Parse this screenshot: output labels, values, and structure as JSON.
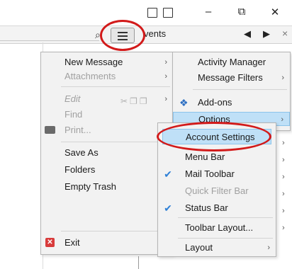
{
  "title_bar": {
    "buttons": [
      {
        "name": "calendar-icon"
      },
      {
        "name": "tasks-icon"
      },
      {
        "name": "minimize",
        "glyph": "–"
      },
      {
        "name": "restore",
        "glyph": "⧉"
      },
      {
        "name": "close",
        "glyph": "✕"
      }
    ]
  },
  "toolbar": {
    "tab_partial": "vents",
    "nav_back": "◀",
    "nav_forward": "▶",
    "tab_close": "×"
  },
  "main_menu": {
    "items": [
      {
        "label": "New Message",
        "arrow": "›",
        "disabled": false
      },
      {
        "label": "Attachments",
        "arrow": "›",
        "disabled": true
      },
      {
        "label": "Edit",
        "arrow": "›",
        "disabled": true,
        "italic": true
      },
      {
        "label": "Find",
        "disabled": true
      },
      {
        "label": "Print...",
        "disabled": true
      },
      {
        "label": "Save As",
        "disabled": false
      },
      {
        "label": "Folders",
        "disabled": false
      },
      {
        "label": "Empty Trash",
        "disabled": false
      },
      {
        "label": "Exit",
        "disabled": false
      }
    ]
  },
  "tools_menu": {
    "items": [
      {
        "label": "Activity Manager"
      },
      {
        "label": "Message Filters",
        "arrow": "›"
      },
      {
        "label": "Add-ons"
      },
      {
        "label": "Options",
        "arrow": "›"
      }
    ]
  },
  "options_submenu": {
    "items": [
      {
        "label": "Account Settings",
        "highlighted": true
      },
      {
        "label": "Menu Bar",
        "arrow": "›"
      },
      {
        "label": "Mail Toolbar",
        "checked": true,
        "arrow": "›"
      },
      {
        "label": "Quick Filter Bar",
        "disabled": true,
        "arrow": "›"
      },
      {
        "label": "Status Bar",
        "checked": true,
        "arrow": "›"
      },
      {
        "label": "Toolbar Layout...",
        "arrow": "›"
      },
      {
        "label": "Layout",
        "arrow": "›"
      }
    ]
  },
  "colors": {
    "highlight": "#bfe0f7",
    "annotation_red": "#d21a1a",
    "check_blue": "#2f80d6"
  }
}
